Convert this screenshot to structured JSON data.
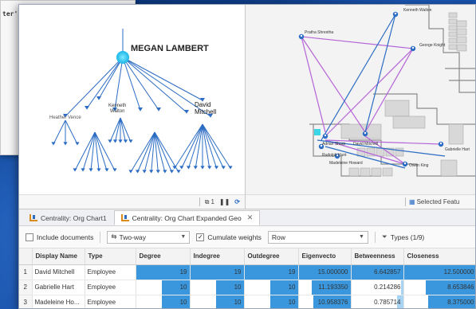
{
  "back_panel": {
    "text": "ter'"
  },
  "colors": {
    "accent": "#2b6cc4",
    "bar": "#3a97de",
    "link_purple": "#b565d8",
    "link_blue": "#2b6cc4"
  },
  "map_left": {
    "root_label": "MEGAN LAMBERT",
    "labels": [
      "Heather Vence",
      "Kenneth\nWalton",
      "David\nMitchell"
    ],
    "toolbar": {
      "page": "1",
      "pause_icon": "pause-icon",
      "refresh_icon": "refresh-icon"
    }
  },
  "map_right": {
    "labels": [
      "Kenneth Walton",
      "Pratha Shrestha",
      "George Knight",
      "Adrian Sharp",
      "David Mitchell",
      "Gabrielle Hart",
      "Madeleine Howard",
      "Owen King",
      "Rudolph Hunt"
    ],
    "toolbar": {
      "selected_label": "Selected Featu"
    }
  },
  "tabs": [
    {
      "label": "Centrality: Org Chart1",
      "active": false
    },
    {
      "label": "Centrality: Org Chart Expanded Geo",
      "active": true,
      "close": "✕"
    }
  ],
  "options": {
    "include_documents": "Include documents",
    "direction": "Two-way",
    "cumulate_weights": "Cumulate weights",
    "row_select": "Row",
    "types": "Types (1/9)"
  },
  "table": {
    "headers": [
      "",
      "Display Name",
      "Type",
      "Degree",
      "Indegree",
      "Outdegree",
      "Eigenvecto",
      "Betweenness",
      "Closeness"
    ],
    "rows": [
      {
        "n": "1",
        "name": "David Mitchell",
        "type": "Employee",
        "degree": "19",
        "indegree": "19",
        "outdegree": "19",
        "eigen": "15.000000",
        "between": "6.642857",
        "close": "12.500000"
      },
      {
        "n": "2",
        "name": "Gabrielle Hart",
        "type": "Employee",
        "degree": "10",
        "indegree": "10",
        "outdegree": "10",
        "eigen": "11.193350",
        "between": "0.214286",
        "close": "8.653846"
      },
      {
        "n": "3",
        "name": "Madeleine Ho...",
        "type": "Employee",
        "degree": "10",
        "indegree": "10",
        "outdegree": "10",
        "eigen": "10.958376",
        "between": "0.785714",
        "close": "8.375000"
      }
    ]
  }
}
